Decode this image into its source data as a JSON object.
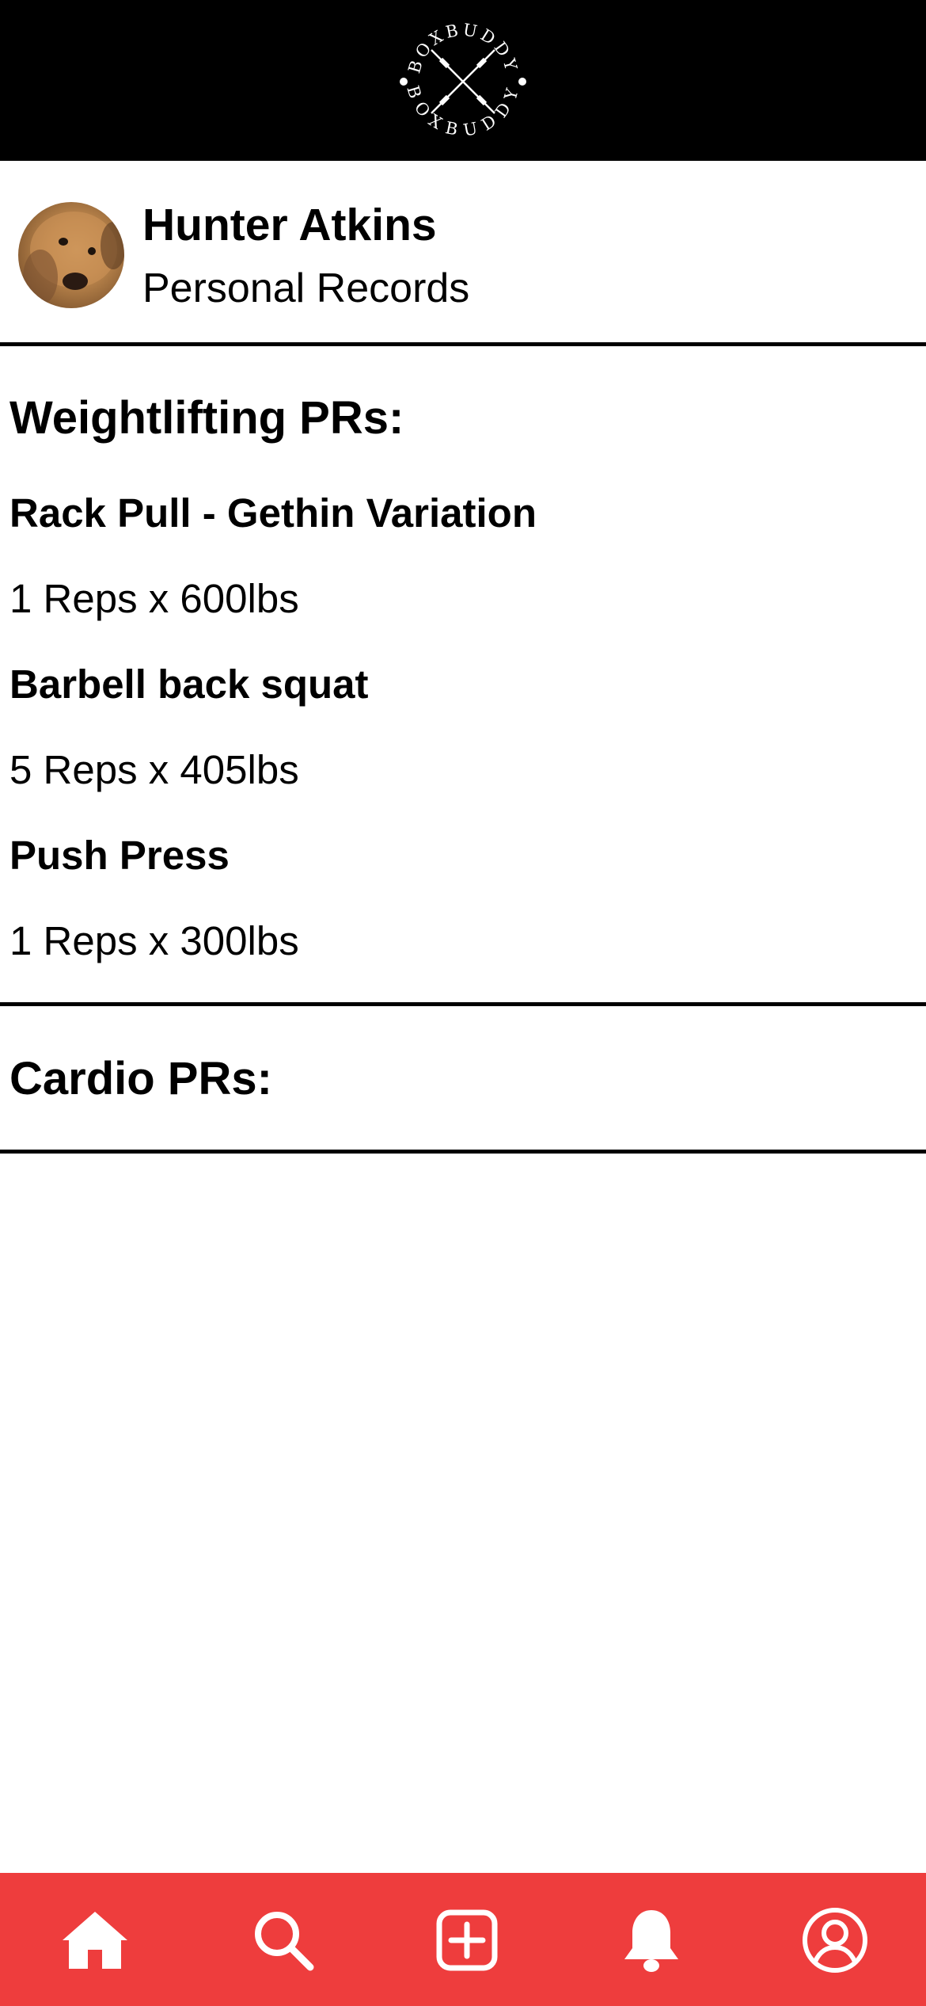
{
  "header": {
    "logo_text": "BOXBUDDY"
  },
  "profile": {
    "name": "Hunter Atkins",
    "subtitle": "Personal Records"
  },
  "weightlifting": {
    "title": "Weightlifting PRs:",
    "items": [
      {
        "exercise": "Rack Pull - Gethin Variation",
        "record": "1 Reps x 600lbs"
      },
      {
        "exercise": "Barbell back squat",
        "record": "5 Reps x 405lbs"
      },
      {
        "exercise": "Push Press",
        "record": "1 Reps x 300lbs"
      }
    ]
  },
  "cardio": {
    "title": "Cardio PRs:"
  },
  "nav": {
    "items": [
      {
        "icon": "home-icon"
      },
      {
        "icon": "search-icon"
      },
      {
        "icon": "add-icon"
      },
      {
        "icon": "bell-icon"
      },
      {
        "icon": "profile-icon"
      }
    ]
  },
  "colors": {
    "header_bg": "#000000",
    "nav_bg": "#ee3d3d",
    "nav_icon": "#ffffff"
  }
}
